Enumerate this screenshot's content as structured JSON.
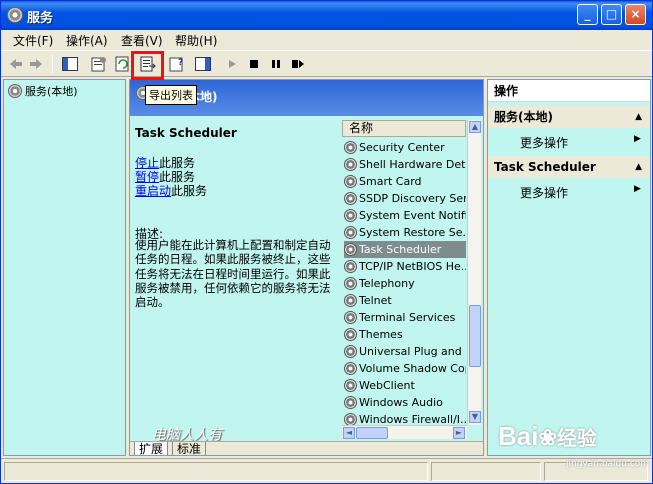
{
  "window": {
    "title": "服务"
  },
  "title_buttons": {
    "minimize": "_",
    "maximize": "□",
    "close": "×"
  },
  "menu": [
    "文件(F)",
    "操作(A)",
    "查看(V)",
    "帮助(H)"
  ],
  "toolbar": {
    "tooltip": "导出列表"
  },
  "tree": {
    "root": "服务(本地)"
  },
  "center": {
    "header": "本地)",
    "service_name": "Task Scheduler",
    "actions": [
      {
        "link": "停止",
        "rest": "此服务"
      },
      {
        "link": "暂停",
        "rest": "此服务"
      },
      {
        "link": "重启动",
        "rest": "此服务"
      }
    ],
    "desc_label": "描述:",
    "description": "使用户能在此计算机上配置和制定自动任务的日程。如果此服务被终止，这些任务将无法在日程时间里运行。如果此服务被禁用，任何依赖它的服务将无法启动。",
    "watermark": "电脑人人有"
  },
  "list": {
    "column": "名称",
    "items": [
      "Security Center",
      "Shell Hardware Det...",
      "Smart Card",
      "SSDP Discovery Ser...",
      "System Event Notifi...",
      "System Restore Se...",
      "Task Scheduler",
      "TCP/IP NetBIOS He...",
      "Telephony",
      "Telnet",
      "Terminal Services",
      "Themes",
      "Universal Plug and ...",
      "Volume Shadow Copy",
      "WebClient",
      "Windows Audio",
      "Windows Firewall/I..."
    ],
    "selected": "Task Scheduler"
  },
  "tabs": [
    "扩展",
    "标准"
  ],
  "actions_panel": {
    "title": "操作",
    "groups": [
      {
        "name": "服务(本地)",
        "more": "更多操作"
      },
      {
        "name": "Task Scheduler",
        "more": "更多操作"
      }
    ]
  },
  "brand": {
    "logo": "Bai",
    "logo2": "经验",
    "sub": "jingyan.baidu.com"
  },
  "colors": {
    "titlebar": "#0054e3",
    "panel": "#c0f5f0",
    "highlight": "#e11111",
    "selected": "#7f8c8d"
  }
}
